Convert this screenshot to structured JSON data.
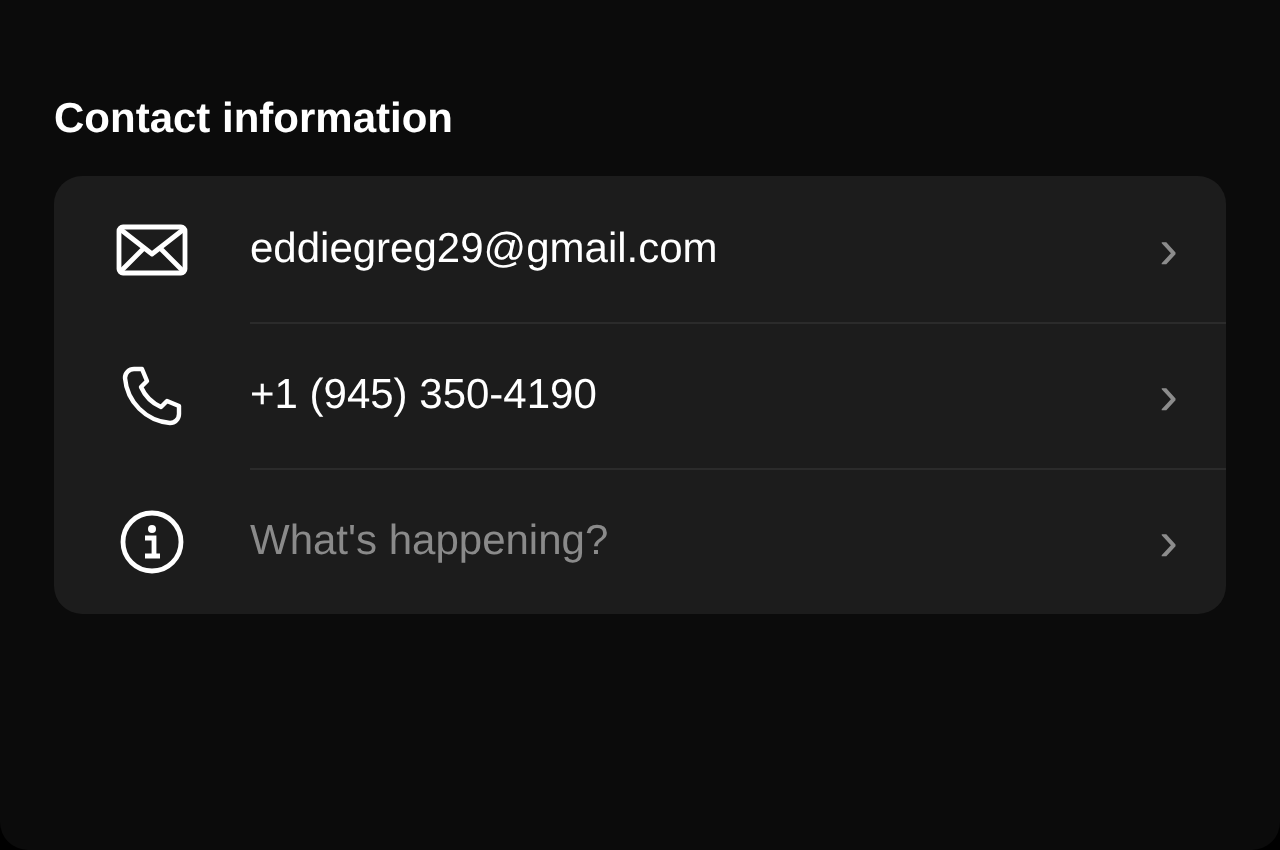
{
  "section": {
    "title": "Contact information"
  },
  "rows": [
    {
      "kind": "email",
      "value": "eddiegreg29@gmail.com",
      "chevron": "›"
    },
    {
      "kind": "phone",
      "value": "+1 (945) 350-4190",
      "chevron": "›"
    },
    {
      "kind": "info",
      "placeholder": "What's happening?",
      "chevron": "›"
    }
  ]
}
